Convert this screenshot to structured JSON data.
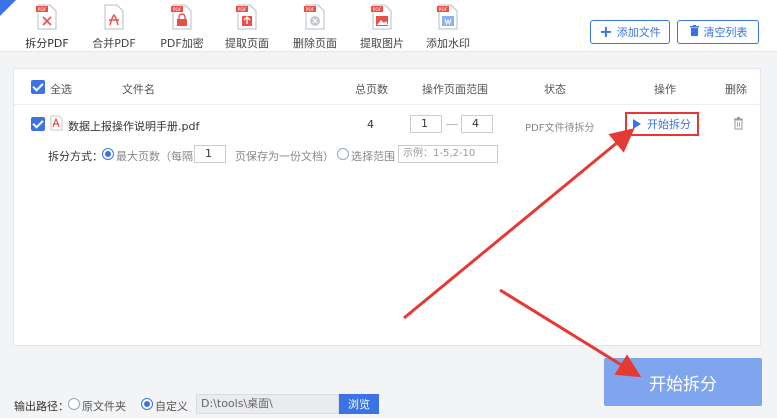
{
  "toolbar": {
    "tools": [
      {
        "label": "拆分PDF",
        "badge": "PDF"
      },
      {
        "label": "合并PDF",
        "badge": ""
      },
      {
        "label": "PDF加密",
        "badge": "PDF"
      },
      {
        "label": "提取页面",
        "badge": "PDF"
      },
      {
        "label": "删除页面",
        "badge": "PDF"
      },
      {
        "label": "提取图片",
        "badge": "PDF"
      },
      {
        "label": "添加水印",
        "badge": "PDF"
      }
    ],
    "add_file_label": "添加文件",
    "clear_list_label": "清空列表"
  },
  "table": {
    "headers": {
      "select_all": "全选",
      "filename": "文件名",
      "total_pages": "总页数",
      "page_range": "操作页面范围",
      "status": "状态",
      "action": "操作",
      "delete": "删除"
    },
    "row": {
      "filename": "数据上报操作说明手册.pdf",
      "total_pages": "4",
      "range_from": "1",
      "range_to": "4",
      "status": "PDF文件待拆分",
      "start_label": "开始拆分"
    },
    "split": {
      "method_label": "拆分方式：",
      "max_pages_label": "最大页数（每隔",
      "every_value": "1",
      "save_suffix": "页保存为一份文档）",
      "select_range_label": "选择范围",
      "range_placeholder": "示例：1-5,2-10"
    }
  },
  "footer": {
    "output_label": "输出路径：",
    "original_folder": "原文件夹",
    "custom": "自定义",
    "path_value": "D:\\tools\\桌面\\",
    "browse_label": "浏览",
    "start_button": "开始拆分"
  },
  "colors": {
    "accent": "#3b73e6",
    "highlight": "#e53935",
    "pdf_red": "#e8504a",
    "big_button": "#7fa5ee"
  }
}
